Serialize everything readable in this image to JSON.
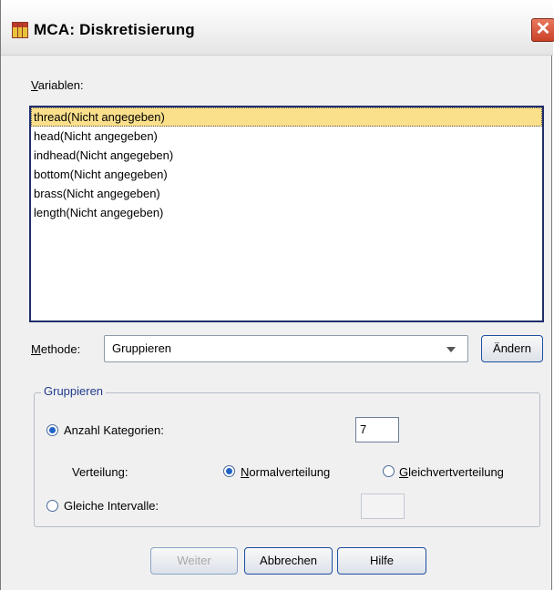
{
  "window": {
    "title": "MCA: Diskretisierung",
    "close_glyph": "✕"
  },
  "variables": {
    "label_accel": "V",
    "label_rest": "ariablen:",
    "items": [
      {
        "label": "thread(Nicht angegeben)",
        "selected": true
      },
      {
        "label": "head(Nicht angegeben)",
        "selected": false
      },
      {
        "label": "indhead(Nicht angegeben)",
        "selected": false
      },
      {
        "label": "bottom(Nicht angegeben)",
        "selected": false
      },
      {
        "label": "brass(Nicht angegeben)",
        "selected": false
      },
      {
        "label": "length(Nicht angegeben)",
        "selected": false
      }
    ]
  },
  "method": {
    "label_accel": "M",
    "label_rest": "ethode:",
    "selected": "Gruppieren",
    "change_label": "Ändern"
  },
  "group": {
    "title": "Gruppieren",
    "anzahl": {
      "label": "Anzahl Kategorien:",
      "value": "7",
      "checked": true
    },
    "verteilung_label": "Verteilung:",
    "normal": {
      "accel": "N",
      "rest": "ormalverteilung",
      "checked": true
    },
    "gleich": {
      "accel": "G",
      "rest": "leichvertverteilung",
      "checked": false
    },
    "intervalle": {
      "label": "Gleiche Intervalle:",
      "checked": false,
      "value": ""
    }
  },
  "buttons": {
    "weiter": "Weiter",
    "abbrechen": "Abbrechen",
    "hilfe": "Hilfe"
  },
  "colors": {
    "selection": "#fbe08c",
    "accent": "#1d4fa3"
  }
}
